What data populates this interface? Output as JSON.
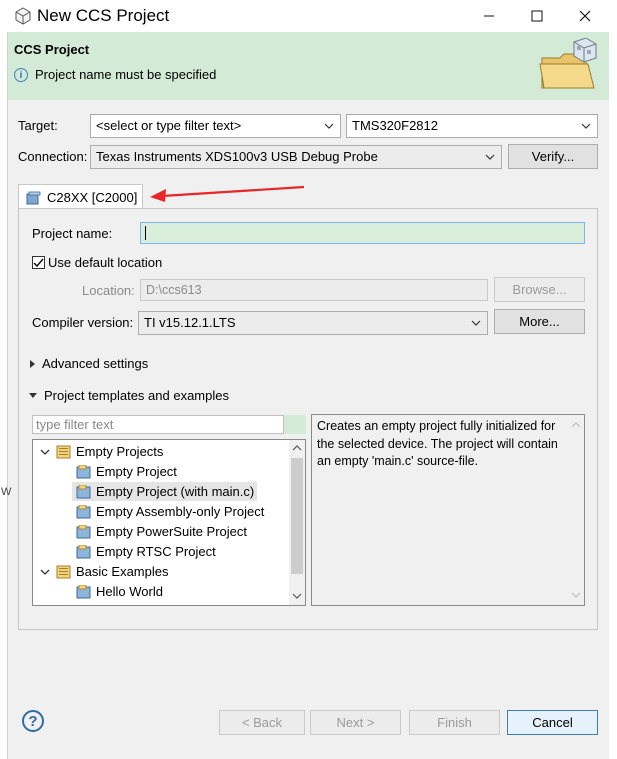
{
  "window": {
    "title": "New CCS Project"
  },
  "banner": {
    "title": "CCS Project",
    "message": "Project name must be specified"
  },
  "target": {
    "label": "Target:",
    "filter_value": "<select or type filter text>",
    "device": "TMS320F2812"
  },
  "connection": {
    "label": "Connection:",
    "value": "Texas Instruments XDS100v3 USB Debug Probe",
    "verify_label": "Verify..."
  },
  "device_tab": {
    "label": "C28XX [C2000]"
  },
  "project": {
    "name_label": "Project name:",
    "name_value": "",
    "use_default_label": "Use default location",
    "use_default_checked": true,
    "location_label": "Location:",
    "location_value": "D:\\ccs613",
    "browse_label": "Browse...",
    "compiler_label": "Compiler version:",
    "compiler_value": "TI v15.12.1.LTS",
    "more_label": "More..."
  },
  "advanced": {
    "label": "Advanced settings",
    "expanded": false
  },
  "templates": {
    "label": "Project templates and examples",
    "expanded": true,
    "filter_placeholder": "type filter text",
    "tree": [
      {
        "label": "Empty Projects",
        "level": 0,
        "expanded": true,
        "icon": "folder-icon"
      },
      {
        "label": "Empty Project",
        "level": 1,
        "icon": "project-icon"
      },
      {
        "label": "Empty Project (with main.c)",
        "level": 1,
        "icon": "project-icon",
        "selected": true
      },
      {
        "label": "Empty Assembly-only Project",
        "level": 1,
        "icon": "project-icon"
      },
      {
        "label": "Empty PowerSuite Project",
        "level": 1,
        "icon": "project-icon"
      },
      {
        "label": "Empty RTSC Project",
        "level": 1,
        "icon": "project-icon"
      },
      {
        "label": "Basic Examples",
        "level": 0,
        "expanded": true,
        "icon": "folder-icon"
      },
      {
        "label": "Hello World",
        "level": 1,
        "icon": "project-icon"
      }
    ],
    "description": "Creates an empty project fully initialized for the selected device. The project will contain an empty 'main.c' source-file."
  },
  "footer": {
    "help": "?",
    "back_label": "< Back",
    "next_label": "Next >",
    "finish_label": "Finish",
    "cancel_label": "Cancel"
  },
  "left_edge_glyph": "W",
  "colors": {
    "banner": "#d3ebd6",
    "input_focus": "#d9efdc",
    "accent": "#3c7fb1",
    "arrow": "#e8262a"
  }
}
